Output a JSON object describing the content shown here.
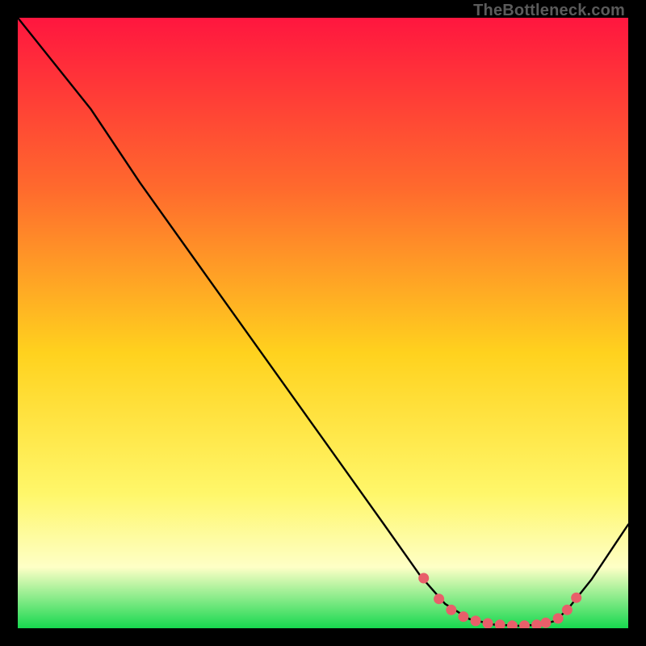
{
  "watermark": "TheBottleneck.com",
  "colors": {
    "gradient_top": "#ff163f",
    "gradient_mid_upper": "#ff6a2d",
    "gradient_mid": "#ffd21e",
    "gradient_lower": "#fff76a",
    "gradient_pale": "#feffc6",
    "gradient_bottom": "#17d84f",
    "curve": "#000000",
    "markers": "#e85f6a"
  },
  "chart_data": {
    "type": "line",
    "title": "",
    "xlabel": "",
    "ylabel": "",
    "xlim": [
      0,
      100
    ],
    "ylim": [
      0,
      100
    ],
    "grid": false,
    "legend": false,
    "series": [
      {
        "name": "bottleneck-curve",
        "x": [
          0,
          8,
          12,
          20,
          30,
          40,
          50,
          60,
          66,
          70,
          74,
          78,
          82,
          86,
          88,
          90,
          94,
          100
        ],
        "y": [
          100,
          90,
          85,
          73,
          59,
          45,
          31,
          17,
          8.5,
          4,
          1.5,
          0.6,
          0.4,
          0.6,
          1.2,
          3,
          8,
          17
        ]
      }
    ],
    "markers": {
      "name": "optimal-range",
      "x": [
        66.5,
        69,
        71,
        73,
        75,
        77,
        79,
        81,
        83,
        85,
        86.5,
        88.5,
        90,
        91.5
      ],
      "y": [
        8.2,
        4.8,
        3.0,
        1.9,
        1.2,
        0.8,
        0.55,
        0.42,
        0.42,
        0.55,
        0.9,
        1.6,
        3.0,
        5.0
      ]
    }
  }
}
